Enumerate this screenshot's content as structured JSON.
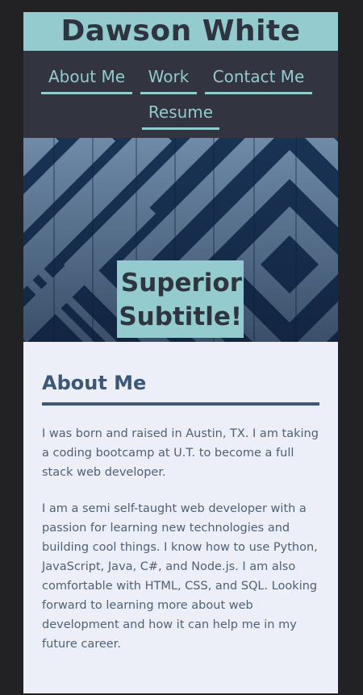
{
  "header": {
    "title": "Dawson White"
  },
  "nav": {
    "items": [
      {
        "label": "About Me"
      },
      {
        "label": "Work"
      },
      {
        "label": "Contact Me"
      },
      {
        "label": "Resume"
      }
    ]
  },
  "hero": {
    "subtitle": "Superior Subtitle!"
  },
  "about": {
    "heading": "About Me",
    "paragraphs": [
      "I was born and raised in Austin, TX. I am taking a coding bootcamp at U.T. to become a full stack web developer.",
      "I am a semi self-taught web developer with a passion for learning new technologies and building cool things. I know how to use Python, JavaScript, Java, C#, and Node.js. I am also comfortable with HTML, CSS, and SQL. Looking forward to learning more about web development and how it can help me in my future career."
    ]
  },
  "colors": {
    "page_background": "#222224",
    "accent_teal": "#93cbce",
    "nav_background": "#32343f",
    "content_background": "#eceff7",
    "heading_blue": "#3e5777",
    "body_text": "#4f6177"
  }
}
